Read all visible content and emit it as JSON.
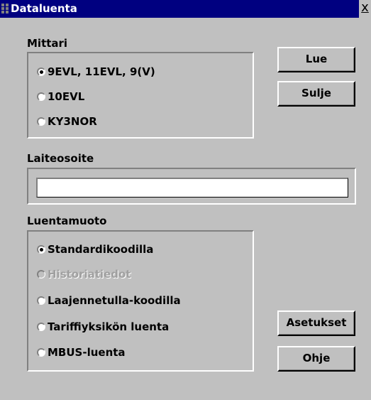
{
  "window": {
    "title": "Dataluenta",
    "close_glyph": "x"
  },
  "mittari": {
    "label": "Mittari",
    "options": [
      {
        "label": "9EVL, 11EVL, 9(V)",
        "checked": true
      },
      {
        "label": "10EVL",
        "checked": false
      },
      {
        "label": "KY3NOR",
        "checked": false
      }
    ]
  },
  "laiteosoite": {
    "label": "Laiteosoite",
    "value": ""
  },
  "luentamuoto": {
    "label": "Luentamuoto",
    "options": [
      {
        "label": "Standardikoodilla",
        "checked": true,
        "disabled": false
      },
      {
        "label": "Historiatiedot",
        "checked": false,
        "disabled": true
      },
      {
        "label": "Laajennetulla-koodilla",
        "checked": false,
        "disabled": false
      },
      {
        "label": "Tariffiyksikön luenta",
        "checked": false,
        "disabled": false
      },
      {
        "label": "MBUS-luenta",
        "checked": false,
        "disabled": false
      }
    ]
  },
  "buttons": {
    "lue": "Lue",
    "sulje": "Sulje",
    "asetukset": "Asetukset",
    "ohje": "Ohje"
  },
  "icons": {
    "window_icon": "app-icon",
    "close": "close-icon"
  }
}
